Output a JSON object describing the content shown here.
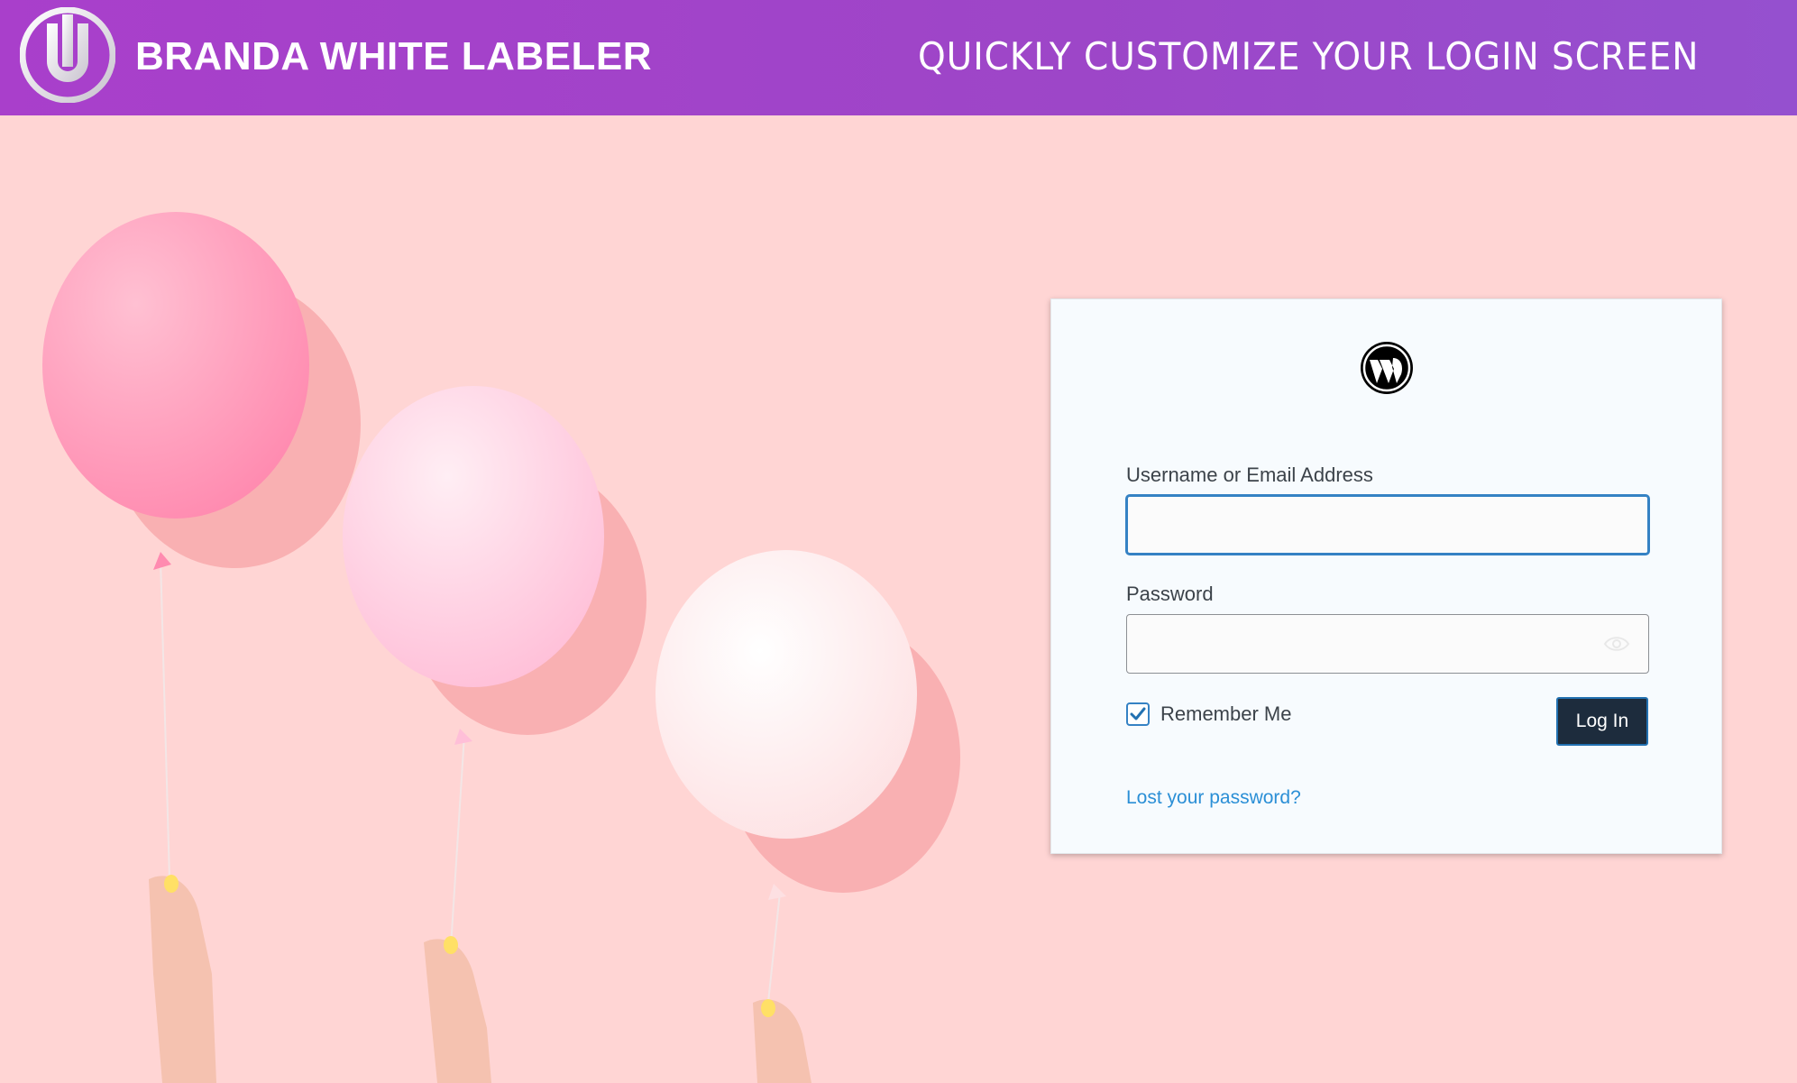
{
  "header": {
    "brand_name": "BRANDA WHITE LABELER",
    "tagline": "QUICKLY CUSTOMIZE YOUR LOGIN SCREEN",
    "background": "#a23fcb"
  },
  "login": {
    "username_label": "Username or Email Address",
    "username_value": "",
    "password_label": "Password",
    "password_value": "",
    "remember_label": "Remember Me",
    "remember_checked": true,
    "login_button": "Log In",
    "lost_password_link": "Lost your password?"
  },
  "colors": {
    "background": "#ffd6d6",
    "button": "#1d2c3d",
    "link": "#2b8fd6",
    "focus": "#3582c4"
  },
  "icons": {
    "brand": "branda-logo-icon",
    "site": "wordpress-logo-icon",
    "password_toggle": "eye-icon",
    "checkbox": "checkmark-icon"
  }
}
